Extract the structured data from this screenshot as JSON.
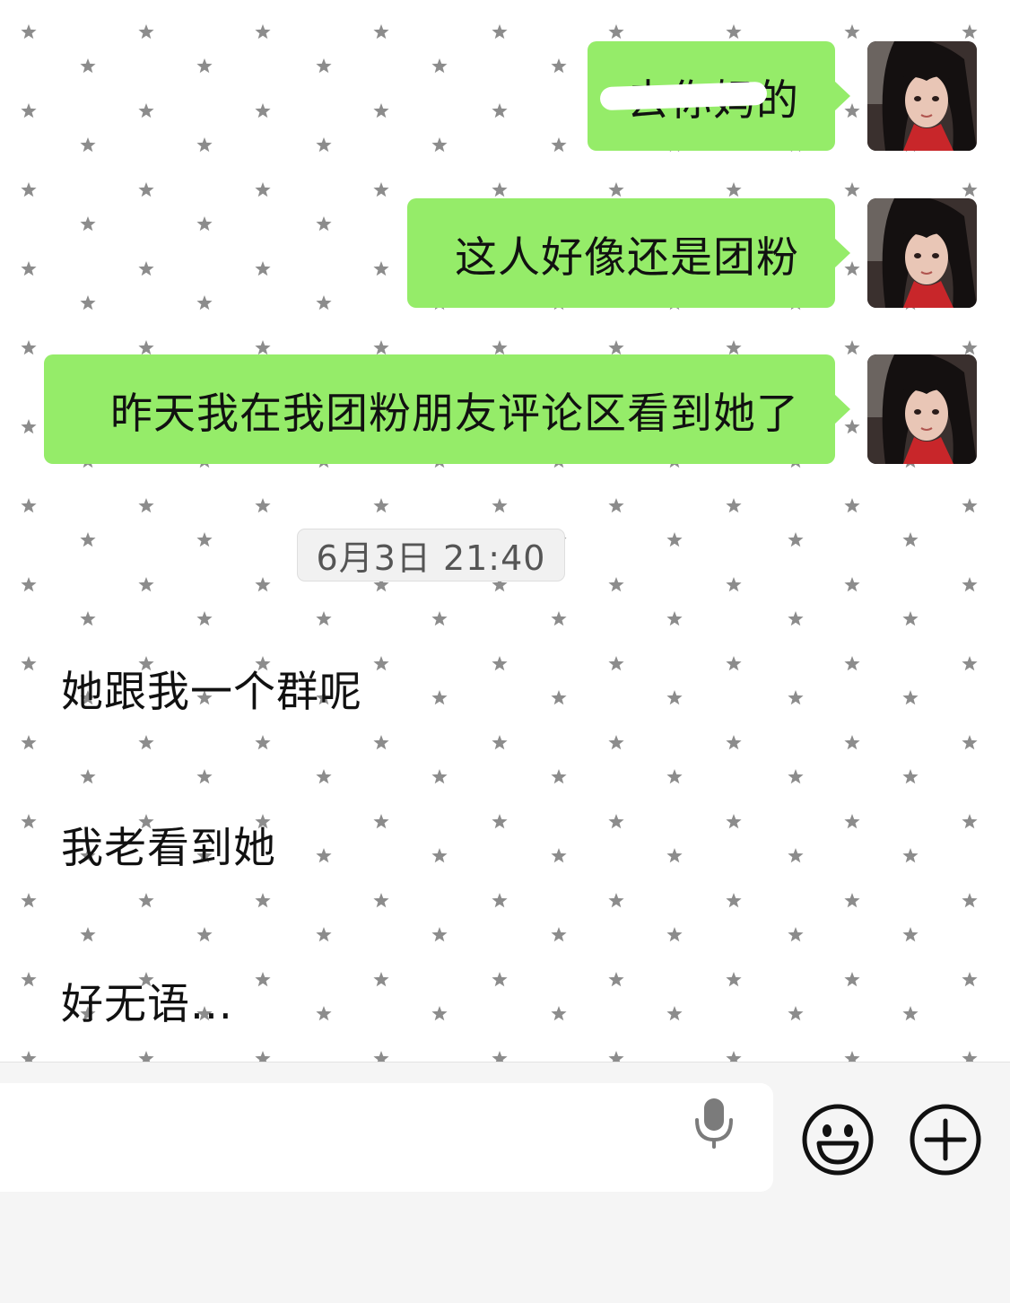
{
  "messages_sent": [
    {
      "text": "去你妈的",
      "redacted": true
    },
    {
      "text": "这人好像还是团粉"
    },
    {
      "text": "昨天我在我团粉朋友评论区看到她了"
    }
  ],
  "timestamp": "6月3日 21:40",
  "messages_received": [
    {
      "text": "她跟我一个群呢"
    },
    {
      "text": "我老看到她"
    },
    {
      "text": "好无语..."
    }
  ],
  "colors": {
    "bubble_sent": "#95ec69",
    "chat_background": "#ffffff",
    "star": "#8c8c8c",
    "toolbar": "#f5f5f5"
  },
  "toolbar": {
    "icons": [
      "microphone-icon",
      "emoji-icon",
      "plus-icon"
    ]
  }
}
